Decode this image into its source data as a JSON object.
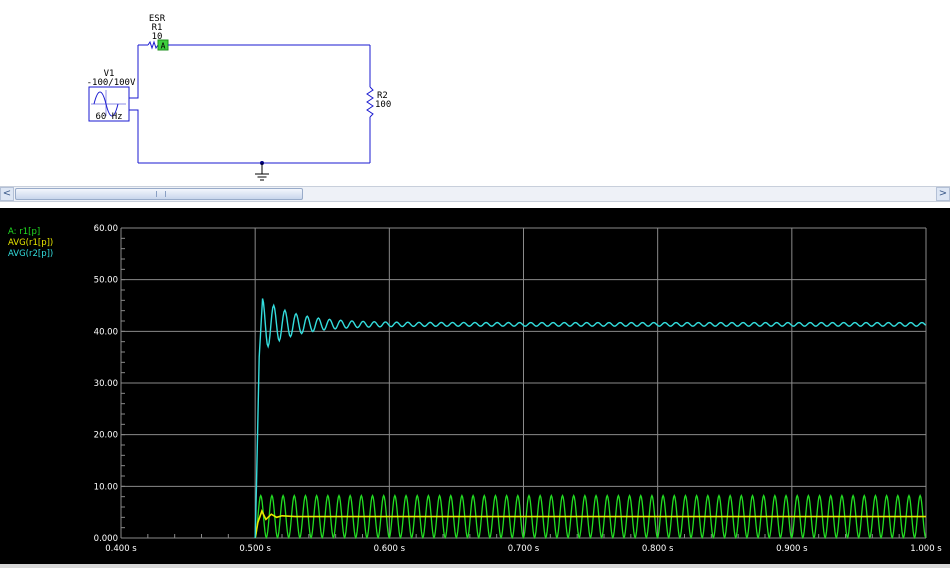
{
  "schematic": {
    "source": {
      "label": "V1",
      "value": "-100/100V",
      "frequency": "60 Hz"
    },
    "esr_resistor": {
      "type_label": "ESR",
      "label": "R1",
      "value": "10",
      "probe": "A"
    },
    "load_resistor": {
      "label": "R2",
      "value": "100"
    }
  },
  "scrollbar": {
    "left_arrow": "<",
    "right_arrow": ">"
  },
  "chart_data": {
    "type": "line",
    "legend_placement": "top-left",
    "grid": true,
    "xlim": [
      0.4,
      1.0
    ],
    "ylim": [
      0,
      60
    ],
    "x_ticks": [
      "0.400 s",
      "0.500 s",
      "0.600 s",
      "0.700 s",
      "0.800 s",
      "0.900 s",
      "1.000 s"
    ],
    "y_ticks": [
      "0.000",
      "10.00",
      "20.00",
      "30.00",
      "40.00",
      "50.00",
      "60.00"
    ],
    "series": [
      {
        "name": "A: r1[p]",
        "color": "#22dd22",
        "x": [
          0.5,
          0.504,
          0.508,
          0.512,
          0.517,
          0.521,
          0.525,
          0.529,
          0.533,
          0.537,
          0.55,
          0.6,
          0.7,
          0.8,
          0.9,
          1.0
        ],
        "y": [
          0,
          8.2,
          0,
          8.2,
          0,
          8.2,
          0,
          8.2,
          0,
          8.2,
          0.1,
          0.1,
          0.1,
          0.1,
          0.1,
          0.1
        ],
        "oscillation": {
          "start": 0.5,
          "end": 1.0,
          "period": 0.00833,
          "min": 0.1,
          "max": 8.2
        }
      },
      {
        "name": "AVG(r1[p])",
        "color": "#e8e800",
        "x": [
          0.5,
          0.502,
          0.505,
          0.508,
          0.512,
          0.516,
          0.52,
          0.53,
          0.6,
          0.7,
          0.8,
          0.9,
          1.0
        ],
        "y": [
          0,
          3.0,
          5.2,
          3.6,
          4.6,
          4.0,
          4.3,
          4.15,
          4.15,
          4.15,
          4.15,
          4.15,
          4.15
        ]
      },
      {
        "name": "AVG(r2[p])",
        "color": "#33dddd",
        "x": [
          0.5,
          0.501,
          0.503,
          0.5055,
          0.509,
          0.5125,
          0.517,
          0.521,
          0.525,
          0.529,
          0.533,
          0.55,
          0.6,
          0.7,
          0.8,
          0.9,
          1.0
        ],
        "y": [
          0,
          10.5,
          35.0,
          50.3,
          36.8,
          45.0,
          38.5,
          43.8,
          39.2,
          42.8,
          40.0,
          41.7,
          41.4,
          41.3,
          41.2,
          41.2,
          41.2
        ],
        "ripple": {
          "start": 0.5,
          "end": 1.0,
          "period": 0.00833,
          "amp_start": 5.0,
          "amp_end": 0.35,
          "decay": 0.025
        }
      }
    ]
  }
}
